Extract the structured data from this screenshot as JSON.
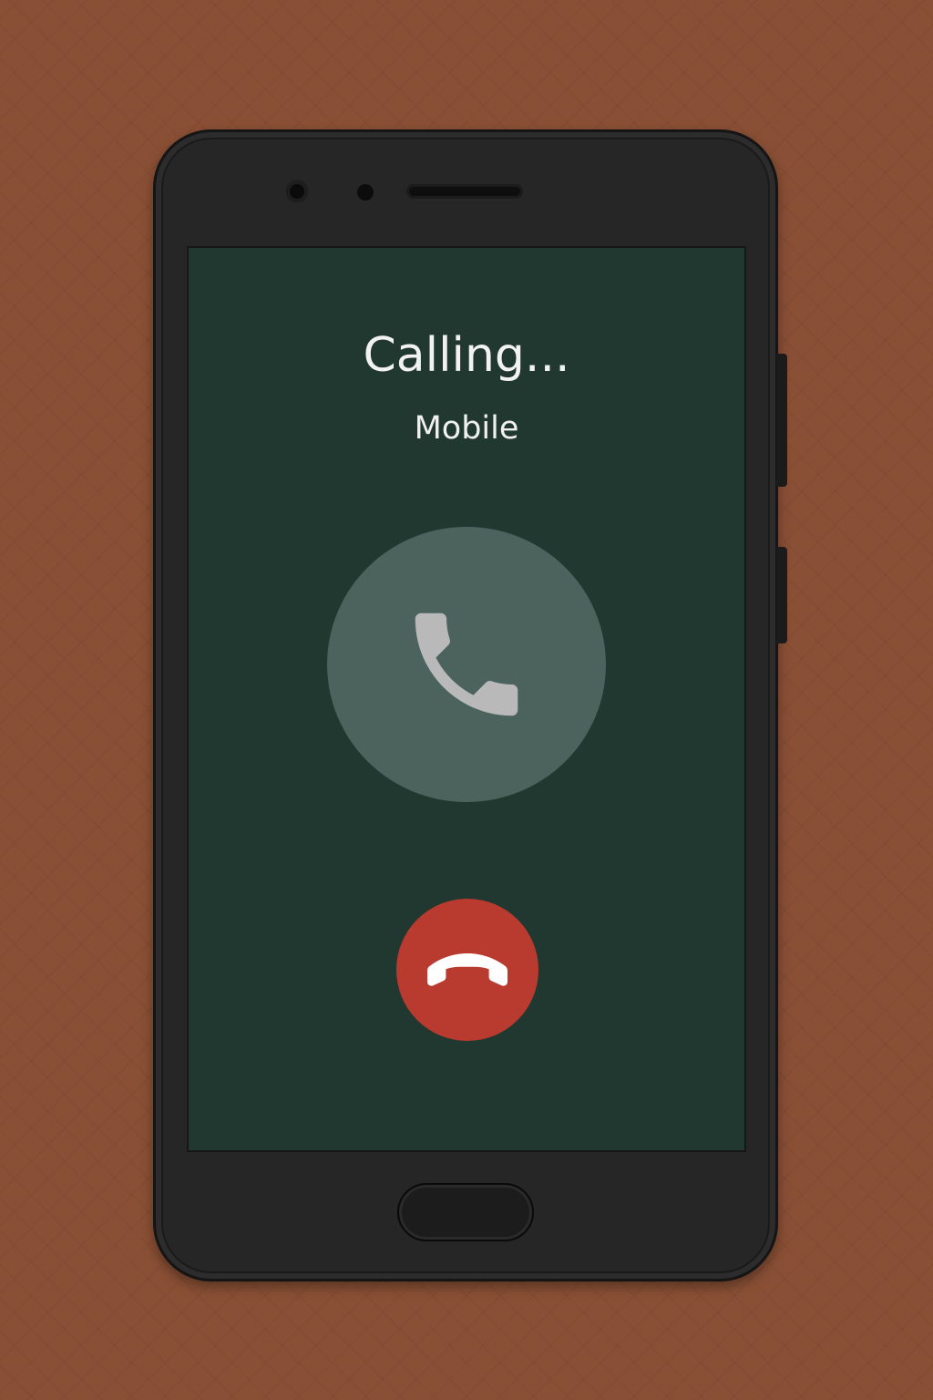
{
  "call": {
    "status": "Calling...",
    "label": "Mobile"
  },
  "icons": {
    "call": "phone-icon",
    "hangup": "phone-hangup-icon"
  },
  "colors": {
    "background": "#8a5035",
    "phone_body": "#262626",
    "screen": "#213830",
    "call_circle": "#4b625d",
    "phone_icon": "#b9b9b9",
    "hangup": "#b93a2f",
    "text": "#f2f2f2"
  }
}
